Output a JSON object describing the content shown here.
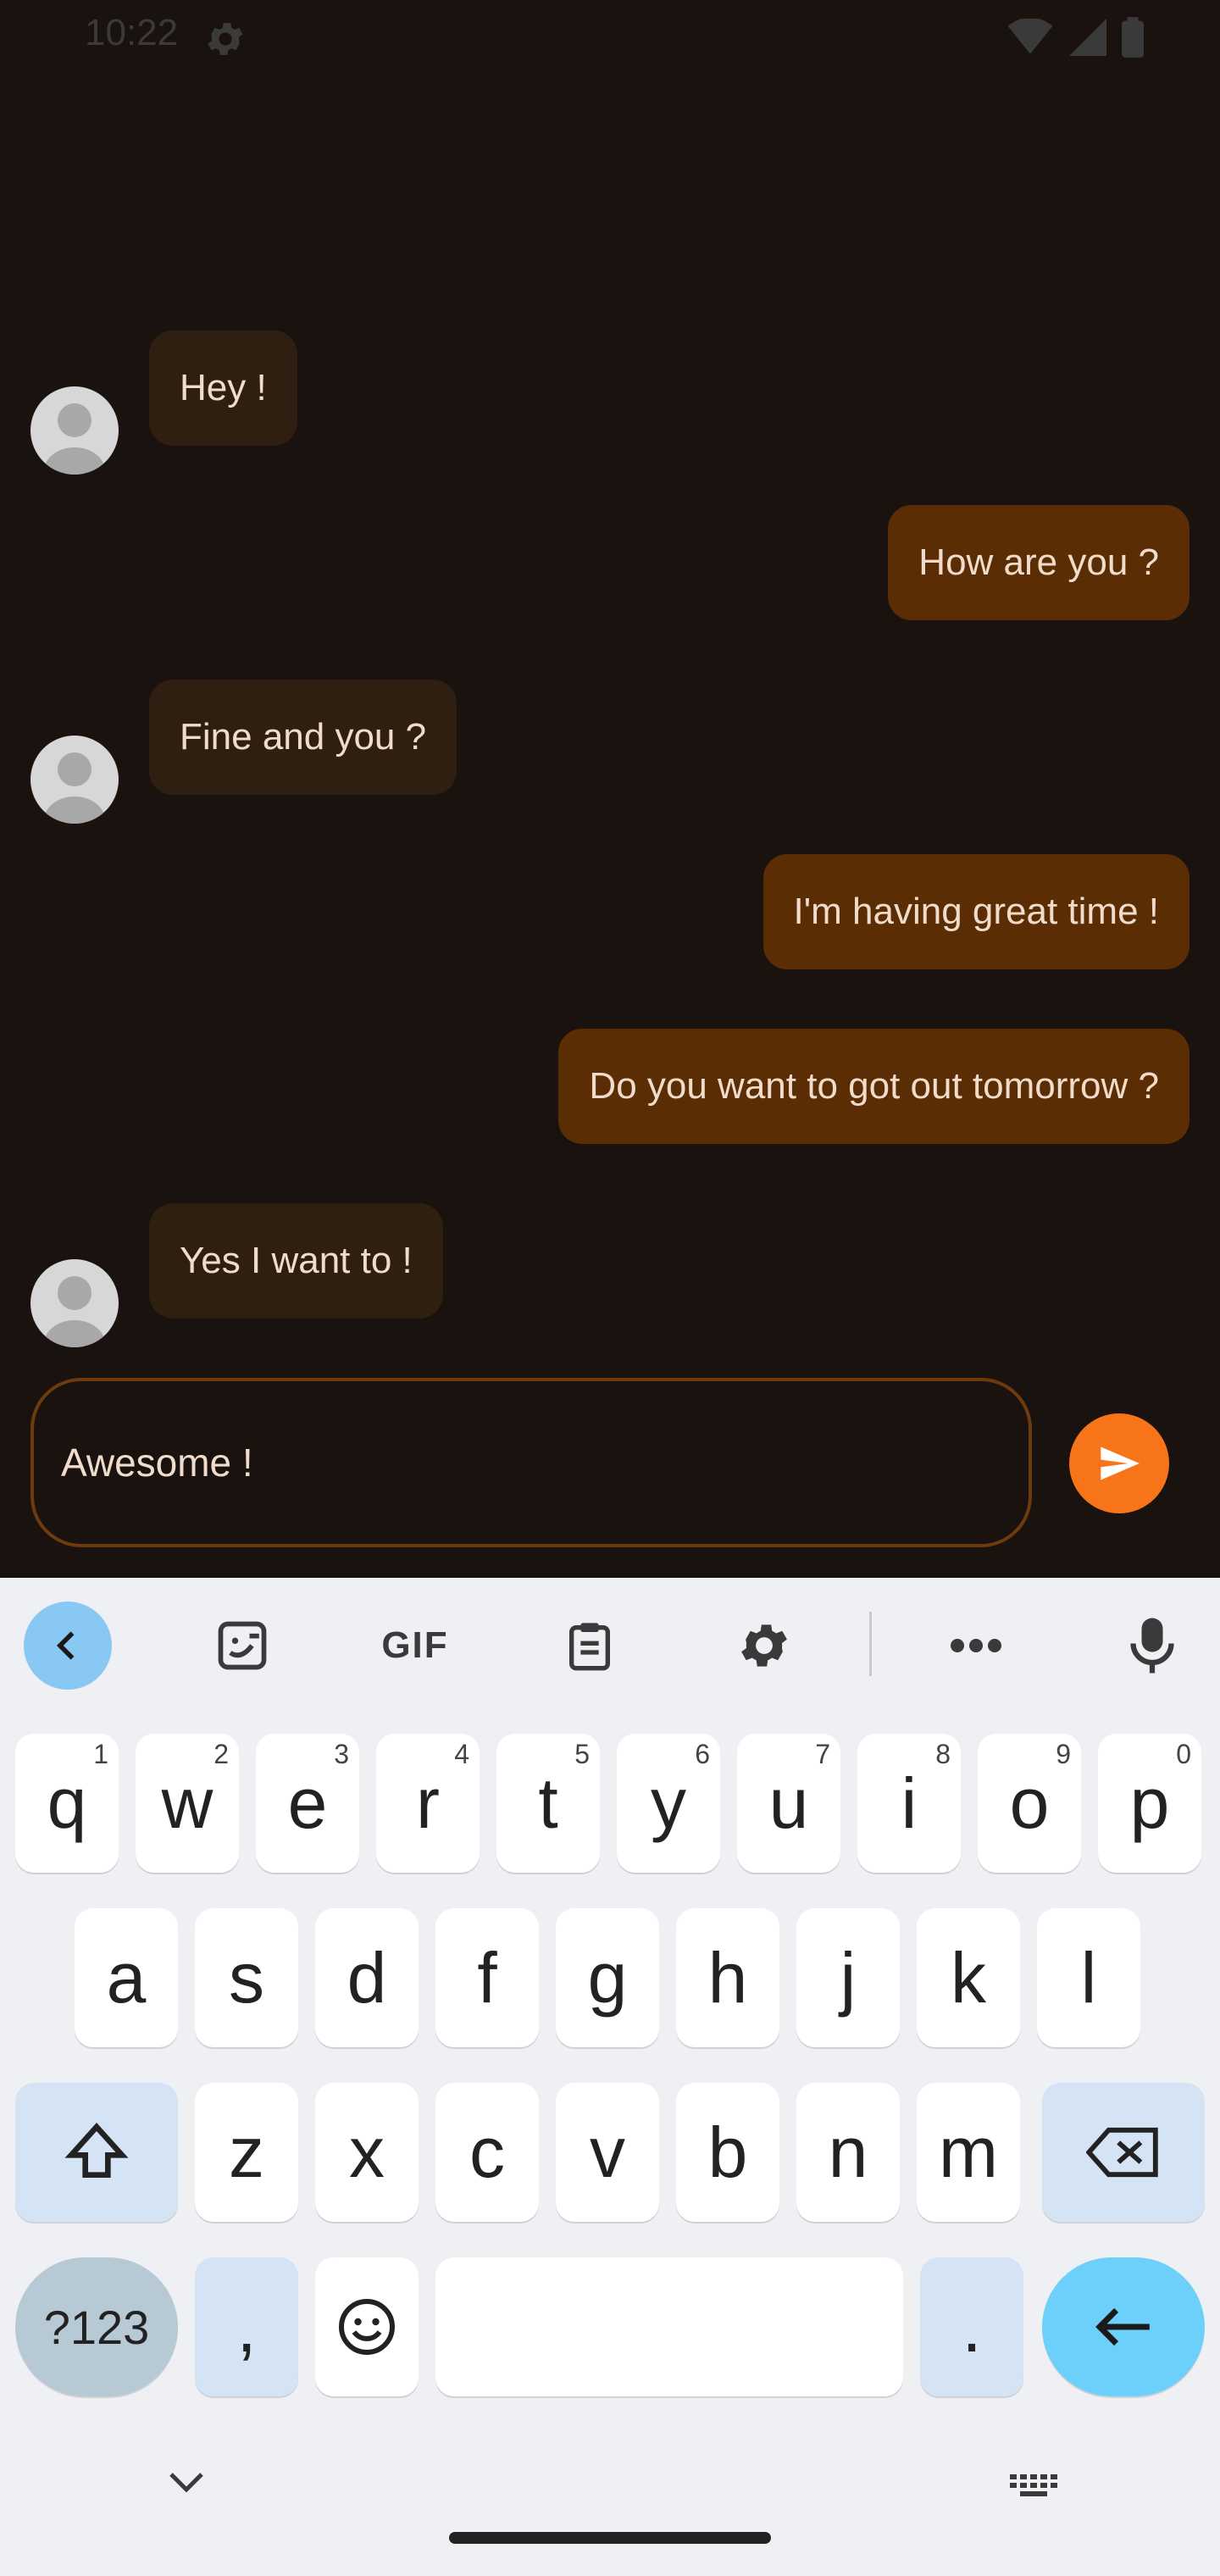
{
  "status_bar": {
    "time": "10:22"
  },
  "messages": [
    {
      "text": "Hey !",
      "direction": "incoming"
    },
    {
      "text": "How are you ?",
      "direction": "outgoing"
    },
    {
      "text": "Fine and you ?",
      "direction": "incoming"
    },
    {
      "text": "I'm having great time !",
      "direction": "outgoing"
    },
    {
      "text": "Do you want to got out tomorrow ?",
      "direction": "outgoing"
    },
    {
      "text": "Yes I want to !",
      "direction": "incoming"
    }
  ],
  "composer": {
    "value": "Awesome !"
  },
  "keyboard": {
    "toolbar": {
      "gif_label": "GIF"
    },
    "row1": [
      {
        "key": "q",
        "hint": "1"
      },
      {
        "key": "w",
        "hint": "2"
      },
      {
        "key": "e",
        "hint": "3"
      },
      {
        "key": "r",
        "hint": "4"
      },
      {
        "key": "t",
        "hint": "5"
      },
      {
        "key": "y",
        "hint": "6"
      },
      {
        "key": "u",
        "hint": "7"
      },
      {
        "key": "i",
        "hint": "8"
      },
      {
        "key": "o",
        "hint": "9"
      },
      {
        "key": "p",
        "hint": "0"
      }
    ],
    "row2": [
      "a",
      "s",
      "d",
      "f",
      "g",
      "h",
      "j",
      "k",
      "l"
    ],
    "row3": [
      "z",
      "x",
      "c",
      "v",
      "b",
      "n",
      "m"
    ],
    "row4": {
      "symbols": "?123",
      "comma": ",",
      "period": "."
    }
  },
  "colors": {
    "background": "#19120f",
    "bubble_in": "#2f1f10",
    "bubble_out": "#5a2d05",
    "accent": "#f77518",
    "keyboard_bg": "#eff0f4"
  }
}
